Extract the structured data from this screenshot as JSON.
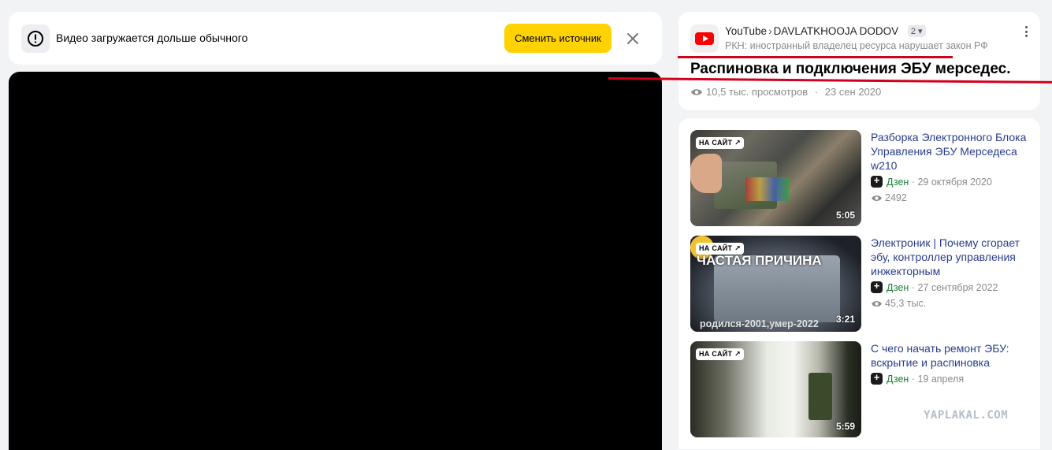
{
  "notice": {
    "text": "Видео загружается дольше обычного",
    "button_label": "Сменить источник"
  },
  "video_info": {
    "source_site": "YouTube",
    "source_sep": "›",
    "channel": "DAVLATKHOOJA DODOV",
    "source_count": "2",
    "rkn_notice": "РКН: иностранный владелец ресурса нарушает закон РФ",
    "title": "Распиновка и подключения ЭБУ мерседес.",
    "views": "10,5 тыс. просмотров",
    "dot": "·",
    "date": "23 сен 2020"
  },
  "related": [
    {
      "badge": "НА САЙТ",
      "duration": "5:05",
      "title": "Разборка Электронного Блока Управления ЭБУ Мерседеса w210",
      "source": "Дзен",
      "date": "· 29 октября 2020",
      "views": "2492"
    },
    {
      "badge": "НА САЙТ",
      "duration": "3:21",
      "overlay_top": "ЧАСТАЯ ПРИЧИНА",
      "overlay_bottom": "родился-2001,умер-2022",
      "title": "Электроник | Почему сгорает эбу, контроллер управления инжекторным",
      "source": "Дзен",
      "date": "· 27 сентября 2022",
      "views": "45,3 тыс."
    },
    {
      "badge": "НА САЙТ",
      "duration": "5:59",
      "title": "С чего начать ремонт ЭБУ: вскрытие и распиновка",
      "source": "Дзен",
      "date": "· 19 апреля",
      "views": ""
    }
  ],
  "watermark": "YAPLAKAL.COM",
  "colors": {
    "accent_button": "#ffd200",
    "annotation_line": "#d0021b",
    "link_title": "#2a3d8f",
    "zen_green": "#1a7f37"
  },
  "icons": [
    "exclamation-icon",
    "close-icon",
    "youtube-icon",
    "more-icon",
    "eye-icon",
    "zen-icon",
    "arrow-out-icon"
  ]
}
